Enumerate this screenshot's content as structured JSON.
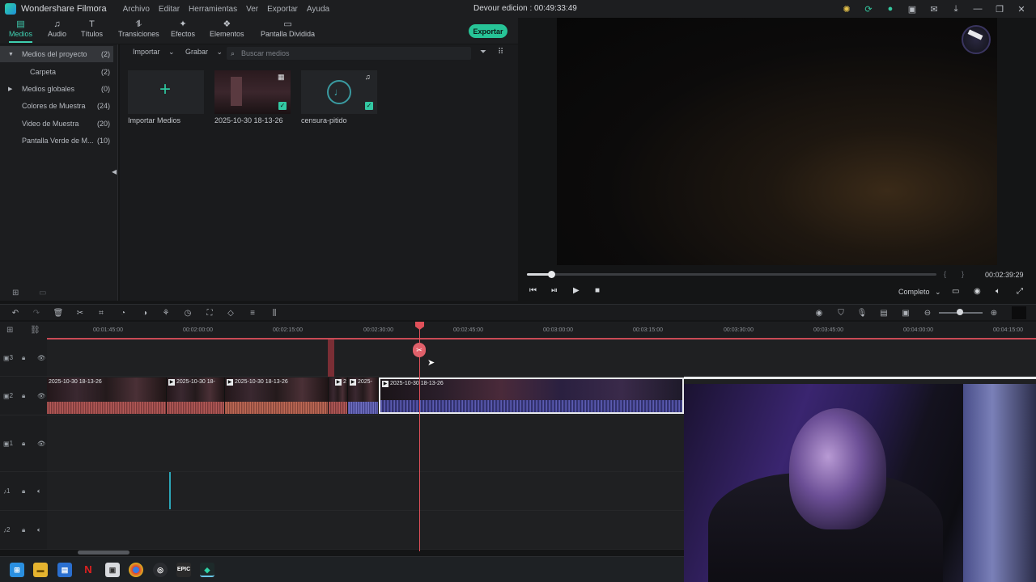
{
  "app": {
    "name": "Wondershare Filmora",
    "window_title": "Devour edicion : 00:49:33:49"
  },
  "menu": [
    "Archivo",
    "Editar",
    "Herramientas",
    "Ver",
    "Exportar",
    "Ayuda"
  ],
  "tool_tabs": [
    {
      "label": "Medios",
      "icon": "media-icon",
      "active": true
    },
    {
      "label": "Audio",
      "icon": "music-note-icon"
    },
    {
      "label": "Títulos",
      "icon": "text-icon"
    },
    {
      "label": "Transiciones",
      "icon": "transition-icon"
    },
    {
      "label": "Efectos",
      "icon": "effects-icon"
    },
    {
      "label": "Elementos",
      "icon": "elements-icon"
    },
    {
      "label": "Pantalla Dividida",
      "icon": "split-screen-icon"
    }
  ],
  "export_label": "Exportar",
  "media_sidebar": [
    {
      "label": "Medios del proyecto",
      "count": "(2)",
      "selected": true,
      "expanded": true
    },
    {
      "label": "Carpeta",
      "count": "(2)",
      "indent": true
    },
    {
      "label": "Medios globales",
      "count": "(0)",
      "collapsed": true
    },
    {
      "label": "Colores de Muestra",
      "count": "(24)"
    },
    {
      "label": "Video de Muestra",
      "count": "(20)"
    },
    {
      "label": "Pantalla Verde de M...",
      "count": "(10)"
    }
  ],
  "media_toolbar": {
    "import_label": "Importar",
    "record_label": "Grabar",
    "search_placeholder": "Buscar medios"
  },
  "media_items": [
    {
      "label": "Importar Medios",
      "type": "import"
    },
    {
      "label": "2025-10-30 18-13-26",
      "type": "video",
      "checked": true
    },
    {
      "label": "censura-pitido",
      "type": "audio",
      "checked": true
    }
  ],
  "preview": {
    "timecode": "00:02:39:29",
    "quality_label": "Completo",
    "progress": 0.06
  },
  "ruler_labels": [
    "00:01:45:00",
    "00:02:00:00",
    "00:02:15:00",
    "00:02:30:00",
    "00:02:45:00",
    "00:03:00:00",
    "00:03:15:00",
    "00:03:30:00",
    "00:03:45:00",
    "00:04:00:00",
    "00:04:15:00"
  ],
  "tracks": [
    {
      "id": "3",
      "type": "video"
    },
    {
      "id": "2",
      "type": "video"
    },
    {
      "id": "1",
      "type": "video"
    },
    {
      "id": "1",
      "type": "audio"
    },
    {
      "id": "2",
      "type": "audio"
    }
  ],
  "clips": [
    {
      "name": "2025-10-30 18-13-26"
    },
    {
      "name": "2025-10-30 18-"
    },
    {
      "name": "2025-10-30 18-13-26"
    },
    {
      "name": "2"
    },
    {
      "name": "2025-"
    },
    {
      "name": "2025-10-30 18-13-26",
      "selected": true
    }
  ],
  "taskbar": [
    "windows-start-icon",
    "file-explorer-icon",
    "store-icon",
    "netflix-icon",
    "capture-icon",
    "chrome-icon",
    "steam-icon",
    "epic-games-icon",
    "filmora-icon"
  ],
  "colors": {
    "accent": "#27c497",
    "playhead": "#e0505a"
  }
}
